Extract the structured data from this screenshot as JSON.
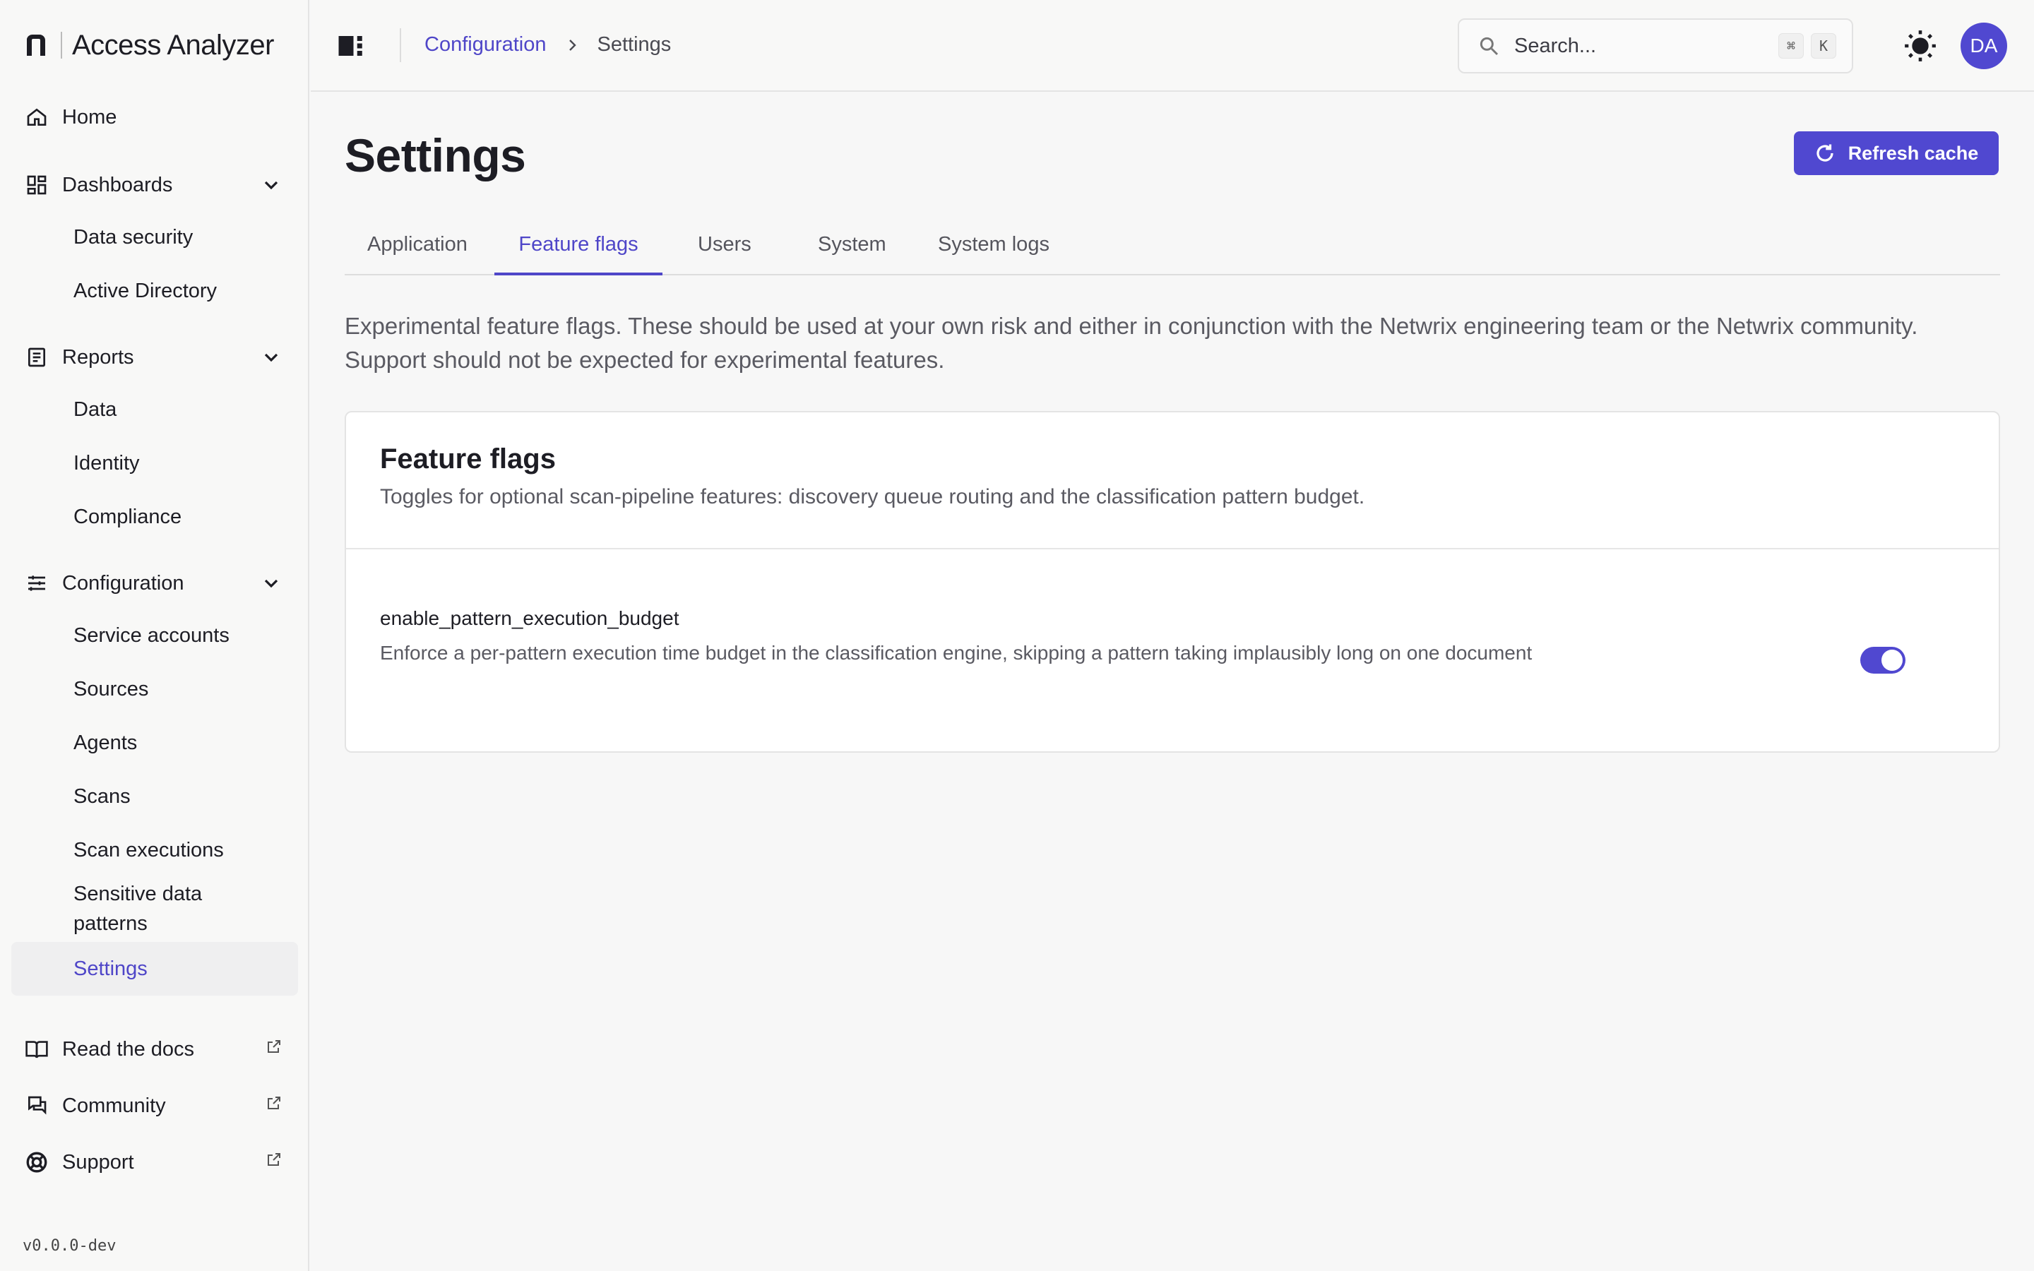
{
  "app": {
    "name": "Access Analyzer",
    "version": "v0.0.0-dev"
  },
  "sidebar": {
    "home": "Home",
    "dashboards": {
      "label": "Dashboards",
      "items": [
        "Data security",
        "Active Directory"
      ]
    },
    "reports": {
      "label": "Reports",
      "items": [
        "Data",
        "Identity",
        "Compliance"
      ]
    },
    "configuration": {
      "label": "Configuration",
      "items": [
        "Service accounts",
        "Sources",
        "Agents",
        "Scans",
        "Scan executions",
        "Sensitive data patterns",
        "Settings"
      ]
    },
    "external": [
      "Read the docs",
      "Community",
      "Support"
    ]
  },
  "topbar": {
    "breadcrumb": {
      "parent": "Configuration",
      "current": "Settings"
    },
    "search": {
      "placeholder": "Search...",
      "shortcut_key1": "⌘",
      "shortcut_key2": "K"
    },
    "avatar_initials": "DA"
  },
  "page": {
    "title": "Settings",
    "refresh_label": "Refresh cache",
    "tabs": [
      "Application",
      "Feature flags",
      "Users",
      "System",
      "System logs"
    ],
    "active_tab": "Feature flags",
    "intro_line1": "Experimental feature flags. These should be used at your own risk and either in conjunction with the Netwrix engineering team or the Netwrix community.",
    "intro_line2": "Support should not be expected for experimental features."
  },
  "card": {
    "title": "Feature flags",
    "subtitle": "Toggles for optional scan-pipeline features: discovery queue routing and the classification pattern budget.",
    "flags": [
      {
        "name": "enable_pattern_execution_budget",
        "description": "Enforce a per-pattern execution time budget in the classification engine, skipping a pattern taking implausibly long on one document",
        "enabled": true
      }
    ]
  },
  "colors": {
    "accent": "#5048d0",
    "active_nav_bg": "#efeff0"
  }
}
